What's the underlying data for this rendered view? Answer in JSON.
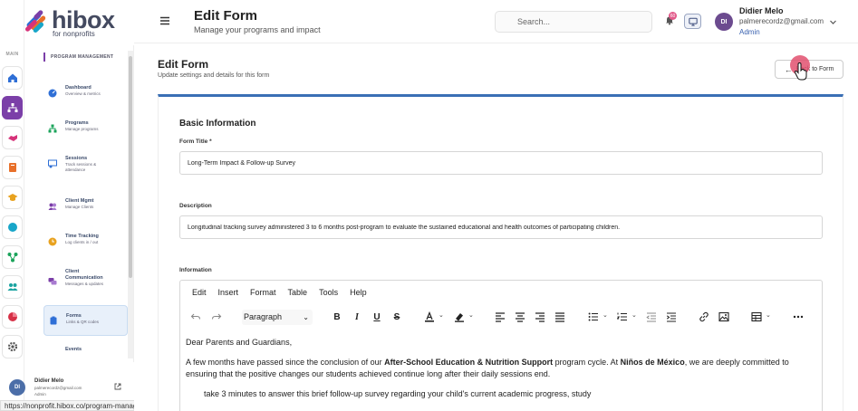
{
  "app": {
    "logo_main": "hibox",
    "logo_sub": "for nonprofits"
  },
  "rail": {
    "section_label": "MAIN"
  },
  "sidebar": {
    "section": "PROGRAM MANAGEMENT",
    "items": [
      {
        "title": "Dashboard",
        "sub": "Overview & metrics"
      },
      {
        "title": "Programs",
        "sub": "Manage programs"
      },
      {
        "title": "Sessions",
        "sub": "Track sessions & attendance"
      },
      {
        "title": "Client Mgmt",
        "sub": "Manage Clients"
      },
      {
        "title": "Time Tracking",
        "sub": "Log clients in / out"
      },
      {
        "title": "Client Communication",
        "sub": "Messages & updates"
      },
      {
        "title": "Forms",
        "sub": "Links & QR codes"
      },
      {
        "title": "Events",
        "sub": ""
      }
    ],
    "user": {
      "initials": "DI",
      "name": "Didier Melo",
      "email": "palmerecordz@gmail.com",
      "role": "Admin"
    }
  },
  "header": {
    "title": "Edit Form",
    "subtitle": "Manage your programs and impact",
    "search_placeholder": "Search...",
    "notification_count": "60",
    "user": {
      "initials": "DI",
      "name": "Didier Melo",
      "email": "palmerecordz@gmail.com",
      "role": "Admin"
    }
  },
  "main": {
    "title": "Edit Form",
    "subtitle": "Update settings and details for this form",
    "back_button": "Back to Form",
    "section_title": "Basic Information",
    "form_title_label": "Form Title *",
    "form_title_value": "Long-Term Impact & Follow-up Survey",
    "description_label": "Description",
    "description_value": "Longitudinal tracking survey administered 3 to 6 months post-program to evaluate the sustained educational and health outcomes of participating children.",
    "information_label": "Information"
  },
  "editor": {
    "menu": [
      "Edit",
      "Insert",
      "Format",
      "Table",
      "Tools",
      "Help"
    ],
    "block_format": "Paragraph",
    "greeting": "Dear Parents and Guardians,",
    "p1_a": "A few months have passed since the conclusion of our ",
    "p1_bold1": "After-School Education & Nutrition Support",
    "p1_b": " program cycle. At ",
    "p1_bold2": "Niños de México",
    "p1_c": ", we are deeply committed to ensuring that the positive changes our students achieved continue long after their daily sessions end.",
    "p2": "take 3 minutes to answer this brief follow-up survey regarding your child's current academic progress, study"
  },
  "status_bar": {
    "url": "https://nonprofit.hibox.co/program-management/forms/dagJOK8w"
  }
}
